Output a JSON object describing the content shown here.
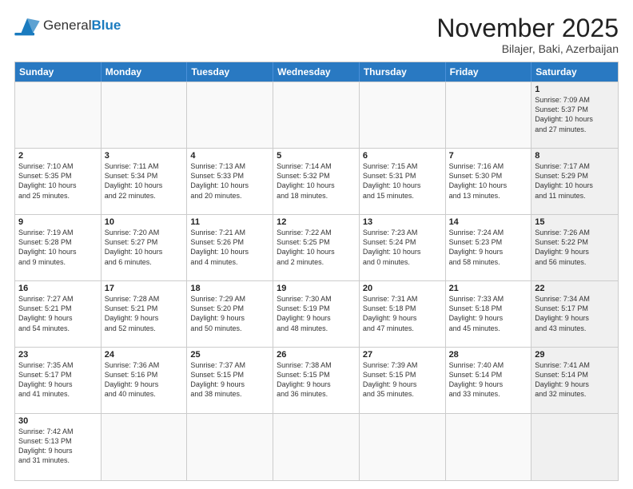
{
  "header": {
    "logo_general": "General",
    "logo_blue": "Blue",
    "title": "November 2025",
    "subtitle": "Bilajer, Baki, Azerbaijan"
  },
  "weekdays": [
    "Sunday",
    "Monday",
    "Tuesday",
    "Wednesday",
    "Thursday",
    "Friday",
    "Saturday"
  ],
  "weeks": [
    [
      {
        "day": "",
        "info": "",
        "empty": true
      },
      {
        "day": "",
        "info": "",
        "empty": true
      },
      {
        "day": "",
        "info": "",
        "empty": true
      },
      {
        "day": "",
        "info": "",
        "empty": true
      },
      {
        "day": "",
        "info": "",
        "empty": true
      },
      {
        "day": "",
        "info": "",
        "empty": true
      },
      {
        "day": "1",
        "info": "Sunrise: 7:09 AM\nSunset: 5:37 PM\nDaylight: 10 hours\nand 27 minutes.",
        "gray": true
      }
    ],
    [
      {
        "day": "2",
        "info": "Sunrise: 7:10 AM\nSunset: 5:35 PM\nDaylight: 10 hours\nand 25 minutes."
      },
      {
        "day": "3",
        "info": "Sunrise: 7:11 AM\nSunset: 5:34 PM\nDaylight: 10 hours\nand 22 minutes."
      },
      {
        "day": "4",
        "info": "Sunrise: 7:13 AM\nSunset: 5:33 PM\nDaylight: 10 hours\nand 20 minutes."
      },
      {
        "day": "5",
        "info": "Sunrise: 7:14 AM\nSunset: 5:32 PM\nDaylight: 10 hours\nand 18 minutes."
      },
      {
        "day": "6",
        "info": "Sunrise: 7:15 AM\nSunset: 5:31 PM\nDaylight: 10 hours\nand 15 minutes."
      },
      {
        "day": "7",
        "info": "Sunrise: 7:16 AM\nSunset: 5:30 PM\nDaylight: 10 hours\nand 13 minutes."
      },
      {
        "day": "8",
        "info": "Sunrise: 7:17 AM\nSunset: 5:29 PM\nDaylight: 10 hours\nand 11 minutes.",
        "gray": true
      }
    ],
    [
      {
        "day": "9",
        "info": "Sunrise: 7:19 AM\nSunset: 5:28 PM\nDaylight: 10 hours\nand 9 minutes."
      },
      {
        "day": "10",
        "info": "Sunrise: 7:20 AM\nSunset: 5:27 PM\nDaylight: 10 hours\nand 6 minutes."
      },
      {
        "day": "11",
        "info": "Sunrise: 7:21 AM\nSunset: 5:26 PM\nDaylight: 10 hours\nand 4 minutes."
      },
      {
        "day": "12",
        "info": "Sunrise: 7:22 AM\nSunset: 5:25 PM\nDaylight: 10 hours\nand 2 minutes."
      },
      {
        "day": "13",
        "info": "Sunrise: 7:23 AM\nSunset: 5:24 PM\nDaylight: 10 hours\nand 0 minutes."
      },
      {
        "day": "14",
        "info": "Sunrise: 7:24 AM\nSunset: 5:23 PM\nDaylight: 9 hours\nand 58 minutes."
      },
      {
        "day": "15",
        "info": "Sunrise: 7:26 AM\nSunset: 5:22 PM\nDaylight: 9 hours\nand 56 minutes.",
        "gray": true
      }
    ],
    [
      {
        "day": "16",
        "info": "Sunrise: 7:27 AM\nSunset: 5:21 PM\nDaylight: 9 hours\nand 54 minutes."
      },
      {
        "day": "17",
        "info": "Sunrise: 7:28 AM\nSunset: 5:21 PM\nDaylight: 9 hours\nand 52 minutes."
      },
      {
        "day": "18",
        "info": "Sunrise: 7:29 AM\nSunset: 5:20 PM\nDaylight: 9 hours\nand 50 minutes."
      },
      {
        "day": "19",
        "info": "Sunrise: 7:30 AM\nSunset: 5:19 PM\nDaylight: 9 hours\nand 48 minutes."
      },
      {
        "day": "20",
        "info": "Sunrise: 7:31 AM\nSunset: 5:18 PM\nDaylight: 9 hours\nand 47 minutes."
      },
      {
        "day": "21",
        "info": "Sunrise: 7:33 AM\nSunset: 5:18 PM\nDaylight: 9 hours\nand 45 minutes."
      },
      {
        "day": "22",
        "info": "Sunrise: 7:34 AM\nSunset: 5:17 PM\nDaylight: 9 hours\nand 43 minutes.",
        "gray": true
      }
    ],
    [
      {
        "day": "23",
        "info": "Sunrise: 7:35 AM\nSunset: 5:17 PM\nDaylight: 9 hours\nand 41 minutes."
      },
      {
        "day": "24",
        "info": "Sunrise: 7:36 AM\nSunset: 5:16 PM\nDaylight: 9 hours\nand 40 minutes."
      },
      {
        "day": "25",
        "info": "Sunrise: 7:37 AM\nSunset: 5:15 PM\nDaylight: 9 hours\nand 38 minutes."
      },
      {
        "day": "26",
        "info": "Sunrise: 7:38 AM\nSunset: 5:15 PM\nDaylight: 9 hours\nand 36 minutes."
      },
      {
        "day": "27",
        "info": "Sunrise: 7:39 AM\nSunset: 5:15 PM\nDaylight: 9 hours\nand 35 minutes."
      },
      {
        "day": "28",
        "info": "Sunrise: 7:40 AM\nSunset: 5:14 PM\nDaylight: 9 hours\nand 33 minutes."
      },
      {
        "day": "29",
        "info": "Sunrise: 7:41 AM\nSunset: 5:14 PM\nDaylight: 9 hours\nand 32 minutes.",
        "gray": true
      }
    ],
    [
      {
        "day": "30",
        "info": "Sunrise: 7:42 AM\nSunset: 5:13 PM\nDaylight: 9 hours\nand 31 minutes."
      },
      {
        "day": "",
        "info": "",
        "empty": true
      },
      {
        "day": "",
        "info": "",
        "empty": true
      },
      {
        "day": "",
        "info": "",
        "empty": true
      },
      {
        "day": "",
        "info": "",
        "empty": true
      },
      {
        "day": "",
        "info": "",
        "empty": true
      },
      {
        "day": "",
        "info": "",
        "empty": true,
        "gray": true
      }
    ]
  ]
}
